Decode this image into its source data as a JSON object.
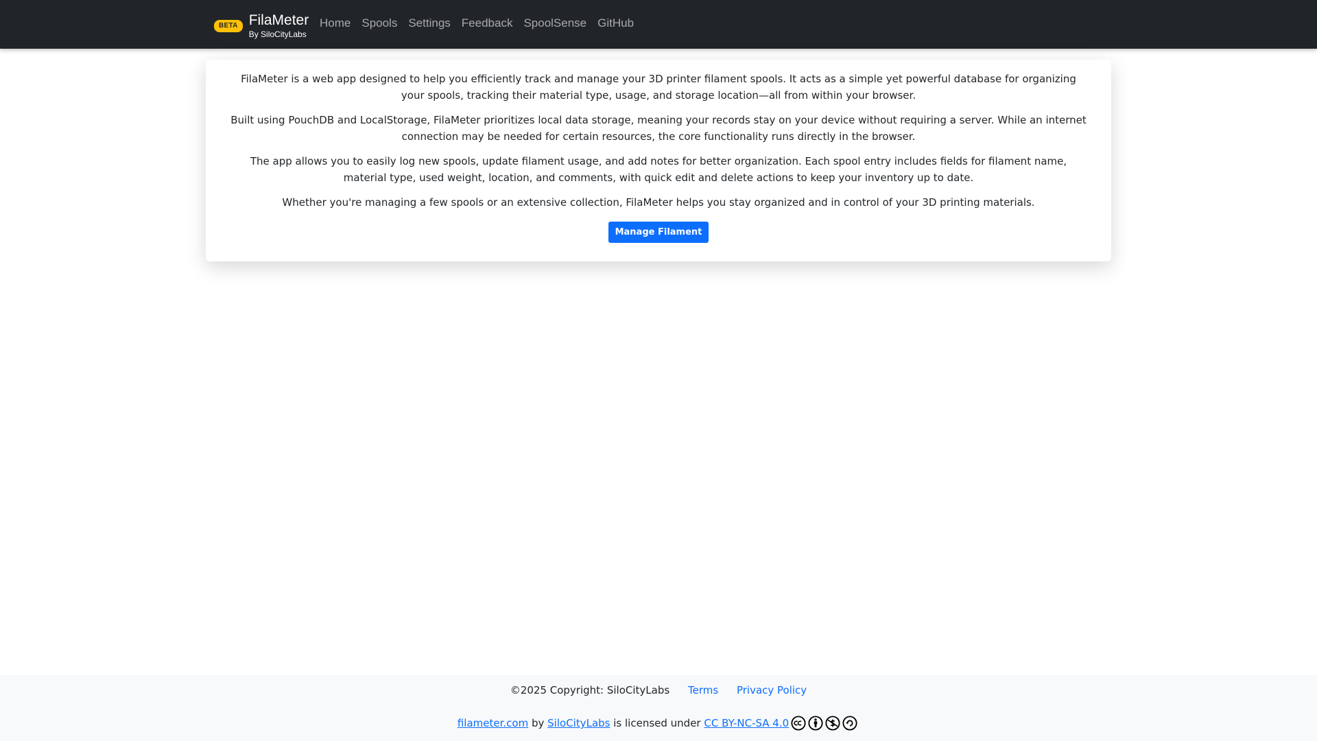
{
  "navbar": {
    "badge": "BETA",
    "title": "FilaMeter",
    "subtitle": "By SiloCityLabs",
    "links": [
      "Home",
      "Spools",
      "Settings",
      "Feedback",
      "SpoolSense",
      "GitHub"
    ]
  },
  "main": {
    "paragraphs": [
      "FilaMeter is a web app designed to help you efficiently track and manage your 3D printer filament spools. It acts as a simple yet powerful database for organizing your spools, tracking their material type, usage, and storage location—all from within your browser.",
      "Built using PouchDB and LocalStorage, FilaMeter prioritizes local data storage, meaning your records stay on your device without requiring a server. While an internet connection may be needed for certain resources, the core functionality runs directly in the browser.",
      "The app allows you to easily log new spools, update filament usage, and add notes for better organization. Each spool entry includes fields for filament name, material type, used weight, location, and comments, with quick edit and delete actions to keep your inventory up to date.",
      "Whether you're managing a few spools or an extensive collection, FilaMeter helps you stay organized and in control of your 3D printing materials."
    ],
    "button_label": "Manage Filament"
  },
  "footer": {
    "copyright": "©2025 Copyright: SiloCityLabs",
    "terms": "Terms",
    "privacy": "Privacy Policy",
    "site_link": "filameter.com",
    "by": "by",
    "author_link": "SiloCityLabs",
    "licensed": "is licensed under",
    "license_link": "CC BY-NC-SA 4.0",
    "license_icons": [
      "cc-icon",
      "by-icon",
      "nc-icon",
      "sa-icon"
    ]
  },
  "colors": {
    "navbar_bg": "#212529",
    "badge": "#ffc107",
    "primary": "#0d6efd",
    "footer_bg": "#f8f9fa"
  }
}
